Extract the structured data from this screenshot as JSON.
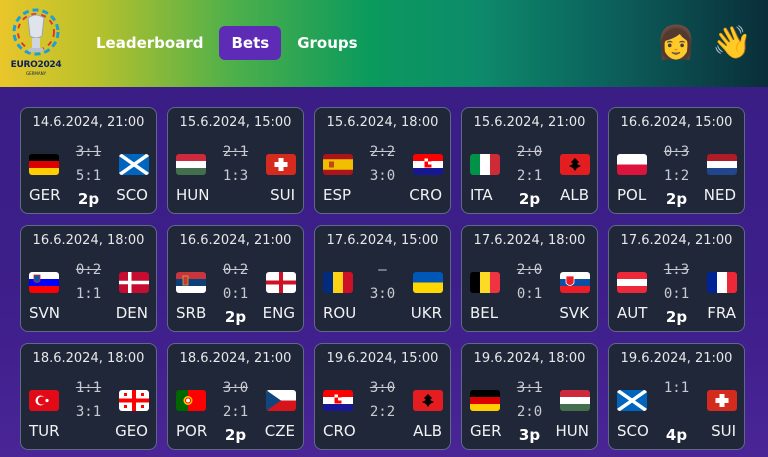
{
  "header": {
    "logo_text": "EURO2024",
    "logo_subtext": "GERMANY",
    "nav": [
      {
        "label": "Leaderboard",
        "active": false
      },
      {
        "label": "Bets",
        "active": true
      },
      {
        "label": "Groups",
        "active": false
      }
    ],
    "avatar_emoji": "👩",
    "wave_emoji": "👋"
  },
  "matches": [
    {
      "date": "14.6.2024, 21:00",
      "home": "GER",
      "away": "SCO",
      "actual": "3:1",
      "bet": "5:1",
      "points": "2p"
    },
    {
      "date": "15.6.2024, 15:00",
      "home": "HUN",
      "away": "SUI",
      "actual": "2:1",
      "bet": "1:3",
      "points": ""
    },
    {
      "date": "15.6.2024, 18:00",
      "home": "ESP",
      "away": "CRO",
      "actual": "2:2",
      "bet": "3:0",
      "points": ""
    },
    {
      "date": "15.6.2024, 21:00",
      "home": "ITA",
      "away": "ALB",
      "actual": "2:0",
      "bet": "2:1",
      "points": "2p"
    },
    {
      "date": "16.6.2024, 15:00",
      "home": "POL",
      "away": "NED",
      "actual": "0:3",
      "bet": "1:2",
      "points": "2p"
    },
    {
      "date": "16.6.2024, 18:00",
      "home": "SVN",
      "away": "DEN",
      "actual": "0:2",
      "bet": "1:1",
      "points": ""
    },
    {
      "date": "16.6.2024, 21:00",
      "home": "SRB",
      "away": "ENG",
      "actual": "0:2",
      "bet": "0:1",
      "points": "2p"
    },
    {
      "date": "17.6.2024, 15:00",
      "home": "ROU",
      "away": "UKR",
      "actual": "–",
      "bet": "3:0",
      "points": ""
    },
    {
      "date": "17.6.2024, 18:00",
      "home": "BEL",
      "away": "SVK",
      "actual": "2:0",
      "bet": "0:1",
      "points": ""
    },
    {
      "date": "17.6.2024, 21:00",
      "home": "AUT",
      "away": "FRA",
      "actual": "1:3",
      "bet": "0:1",
      "points": "2p"
    },
    {
      "date": "18.6.2024, 18:00",
      "home": "TUR",
      "away": "GEO",
      "actual": "1:1",
      "bet": "3:1",
      "points": ""
    },
    {
      "date": "18.6.2024, 21:00",
      "home": "POR",
      "away": "CZE",
      "actual": "3:0",
      "bet": "2:1",
      "points": "2p"
    },
    {
      "date": "19.6.2024, 15:00",
      "home": "CRO",
      "away": "ALB",
      "actual": "3:0",
      "bet": "2:2",
      "points": ""
    },
    {
      "date": "19.6.2024, 18:00",
      "home": "GER",
      "away": "HUN",
      "actual": "3:1",
      "bet": "2:0",
      "points": "3p"
    },
    {
      "date": "19.6.2024, 21:00",
      "home": "SCO",
      "away": "SUI",
      "actual": "1:1",
      "bet": "",
      "points": "4p"
    }
  ],
  "flag_icons": {
    "GER": "germany-flag-icon",
    "SCO": "scotland-flag-icon",
    "HUN": "hungary-flag-icon",
    "SUI": "switzerland-flag-icon",
    "ESP": "spain-flag-icon",
    "CRO": "croatia-flag-icon",
    "ITA": "italy-flag-icon",
    "ALB": "albania-flag-icon",
    "POL": "poland-flag-icon",
    "NED": "netherlands-flag-icon",
    "SVN": "slovenia-flag-icon",
    "DEN": "denmark-flag-icon",
    "SRB": "serbia-flag-icon",
    "ENG": "england-flag-icon",
    "ROU": "romania-flag-icon",
    "UKR": "ukraine-flag-icon",
    "BEL": "belgium-flag-icon",
    "SVK": "slovakia-flag-icon",
    "AUT": "austria-flag-icon",
    "FRA": "france-flag-icon",
    "TUR": "turkey-flag-icon",
    "GEO": "georgia-flag-icon",
    "POR": "portugal-flag-icon",
    "CZE": "czechia-flag-icon"
  },
  "colors": {
    "active_tab": "#5d2bb6",
    "card_bg": "#1f2738",
    "card_border": "#5f6a86"
  }
}
